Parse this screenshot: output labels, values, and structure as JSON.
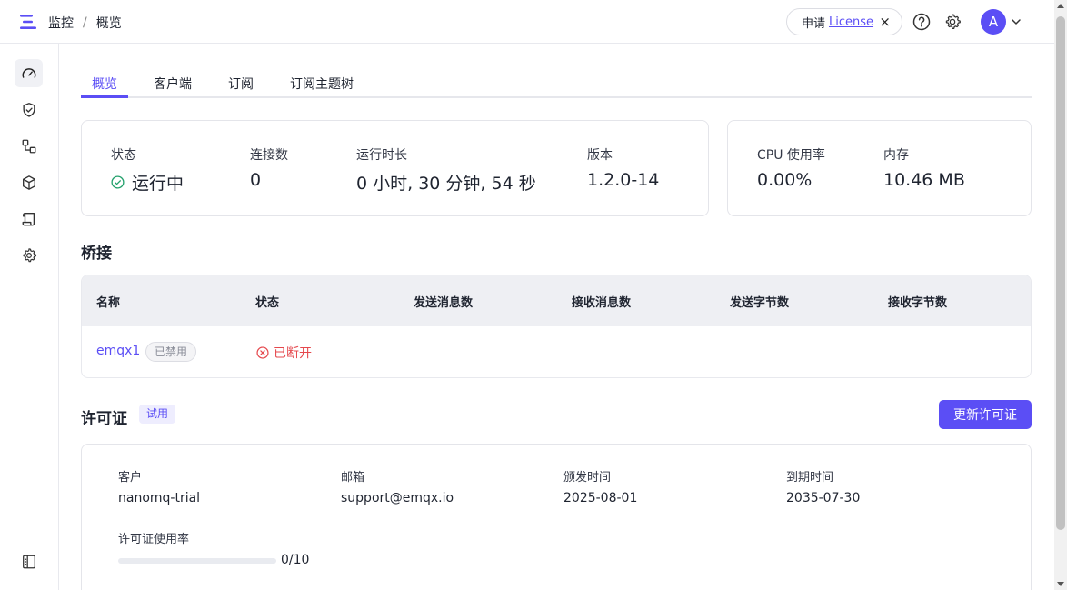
{
  "header": {
    "breadcrumb": [
      "监控",
      "概览"
    ],
    "breadcrumb_sep": "/",
    "license_apply": "申请",
    "license_link": "License",
    "close_glyph": "×",
    "avatar_initial": "A"
  },
  "sidebar": {
    "items": [
      {
        "icon": "dashboard-gauge-icon",
        "active": true
      },
      {
        "icon": "shield-check-icon",
        "active": false
      },
      {
        "icon": "bridge-nodes-icon",
        "active": false
      },
      {
        "icon": "cube-icon",
        "active": false
      },
      {
        "icon": "scroll-log-icon",
        "active": false
      },
      {
        "icon": "gear-icon",
        "active": false
      }
    ],
    "collapse_icon": "sidebar-collapse-icon"
  },
  "tabs": [
    {
      "label": "概览",
      "active": true
    },
    {
      "label": "客户端",
      "active": false
    },
    {
      "label": "订阅",
      "active": false
    },
    {
      "label": "订阅主题树",
      "active": false
    }
  ],
  "overview": {
    "status_label": "状态",
    "status_value": "运行中",
    "connections_label": "连接数",
    "connections_value": "0",
    "uptime_label": "运行时长",
    "uptime_value": "0 小时, 30 分钟, 54 秒",
    "version_label": "版本",
    "version_value": "1.2.0-14",
    "cpu_label": "CPU 使用率",
    "cpu_value": "0.00%",
    "memory_label": "内存",
    "memory_value": "10.46 MB"
  },
  "bridge": {
    "title": "桥接",
    "columns": [
      "名称",
      "状态",
      "发送消息数",
      "接收消息数",
      "发送字节数",
      "接收字节数"
    ],
    "rows": [
      {
        "name": "emqx1",
        "tag": "已禁用",
        "status": "已断开"
      }
    ]
  },
  "license": {
    "title": "许可证",
    "trial_tag": "试用",
    "renew_button": "更新许可证",
    "customer_label": "客户",
    "customer_value": "nanomq-trial",
    "email_label": "邮箱",
    "email_value": "support@emqx.io",
    "issued_label": "颁发时间",
    "issued_value": "2025-08-01",
    "expiry_label": "到期时间",
    "expiry_value": "2035-07-30",
    "usage_label": "许可证使用率",
    "usage_text": "0/10",
    "usage_fraction": 0
  },
  "colors": {
    "accent": "#5b4ef5",
    "success": "#22a06b",
    "danger": "#e5484d"
  }
}
